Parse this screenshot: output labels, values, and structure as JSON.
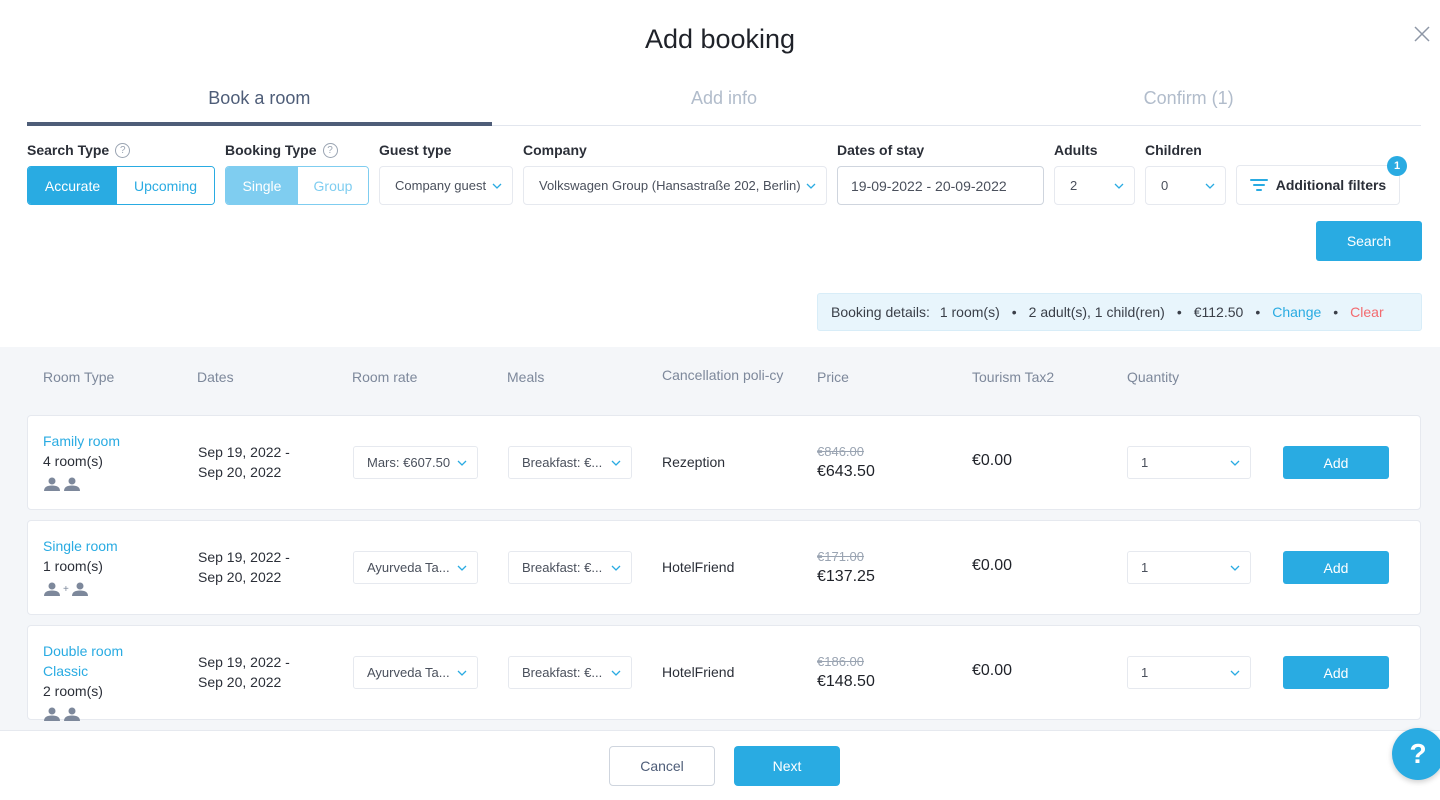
{
  "modal": {
    "title": "Add booking"
  },
  "tabs": [
    {
      "label": "Book a room",
      "active": true
    },
    {
      "label": "Add info",
      "active": false
    },
    {
      "label": "Confirm (1)",
      "active": false
    }
  ],
  "filters": {
    "search_type": {
      "label": "Search Type",
      "options": [
        "Accurate",
        "Upcoming"
      ],
      "selected": "Accurate"
    },
    "booking_type": {
      "label": "Booking Type",
      "options": [
        "Single",
        "Group"
      ],
      "selected": "Single"
    },
    "guest_type": {
      "label": "Guest type",
      "value": "Company guest"
    },
    "company": {
      "label": "Company",
      "value": "Volkswagen Group (Hansastraße 202, Berlin)"
    },
    "dates": {
      "label": "Dates of stay",
      "value": "19-09-2022 - 20-09-2022"
    },
    "adults": {
      "label": "Adults",
      "value": "2"
    },
    "children": {
      "label": "Children",
      "value": "0"
    },
    "additional_filters": {
      "label": "Additional filters",
      "badge": "1"
    },
    "search_label": "Search"
  },
  "booking_details": {
    "label": "Booking details:",
    "rooms": "1 room(s)",
    "guests": "2 adult(s), 1 child(ren)",
    "price": "€112.50",
    "change": "Change",
    "clear": "Clear"
  },
  "table": {
    "headers": [
      "Room Type",
      "Dates",
      "Room rate",
      "Meals",
      "Cancellation poli-cy",
      "Price",
      "Tourism Tax2",
      "Quantity"
    ],
    "rows": [
      {
        "room_name_1": "Family room",
        "room_name_2": "",
        "rooms": "4 room(s)",
        "guest_icons": "two-adults",
        "date_from": "Sep 19, 2022 -",
        "date_to": "Sep 20, 2022",
        "rate": "Mars: €607.50",
        "meals": "Breakfast: €...",
        "policy": "Rezeption",
        "old_price": "€846.00",
        "price": "€643.50",
        "tax": "€0.00",
        "quantity": "1",
        "add_label": "Add"
      },
      {
        "room_name_1": "Single room",
        "room_name_2": "",
        "rooms": "1 room(s)",
        "guest_icons": "adult-plus-adult",
        "date_from": "Sep 19, 2022 -",
        "date_to": "Sep 20, 2022",
        "rate": "Ayurveda Ta...",
        "meals": "Breakfast: €...",
        "policy": "HotelFriend",
        "old_price": "€171.00",
        "price": "€137.25",
        "tax": "€0.00",
        "quantity": "1",
        "add_label": "Add"
      },
      {
        "room_name_1": "Double room",
        "room_name_2": "Classic",
        "rooms": "2 room(s)",
        "guest_icons": "two-adults",
        "date_from": "Sep 19, 2022 -",
        "date_to": "Sep 20, 2022",
        "rate": "Ayurveda Ta...",
        "meals": "Breakfast: €...",
        "policy": "HotelFriend",
        "old_price": "€186.00",
        "price": "€148.50",
        "tax": "€0.00",
        "quantity": "1",
        "add_label": "Add"
      }
    ]
  },
  "footer": {
    "cancel": "Cancel",
    "next": "Next"
  },
  "help_fab": "?",
  "colors": {
    "accent": "#29abe2",
    "accent_light": "#7fcdf0",
    "danger": "#f36a6f",
    "tab_active": "#4e5d78"
  }
}
